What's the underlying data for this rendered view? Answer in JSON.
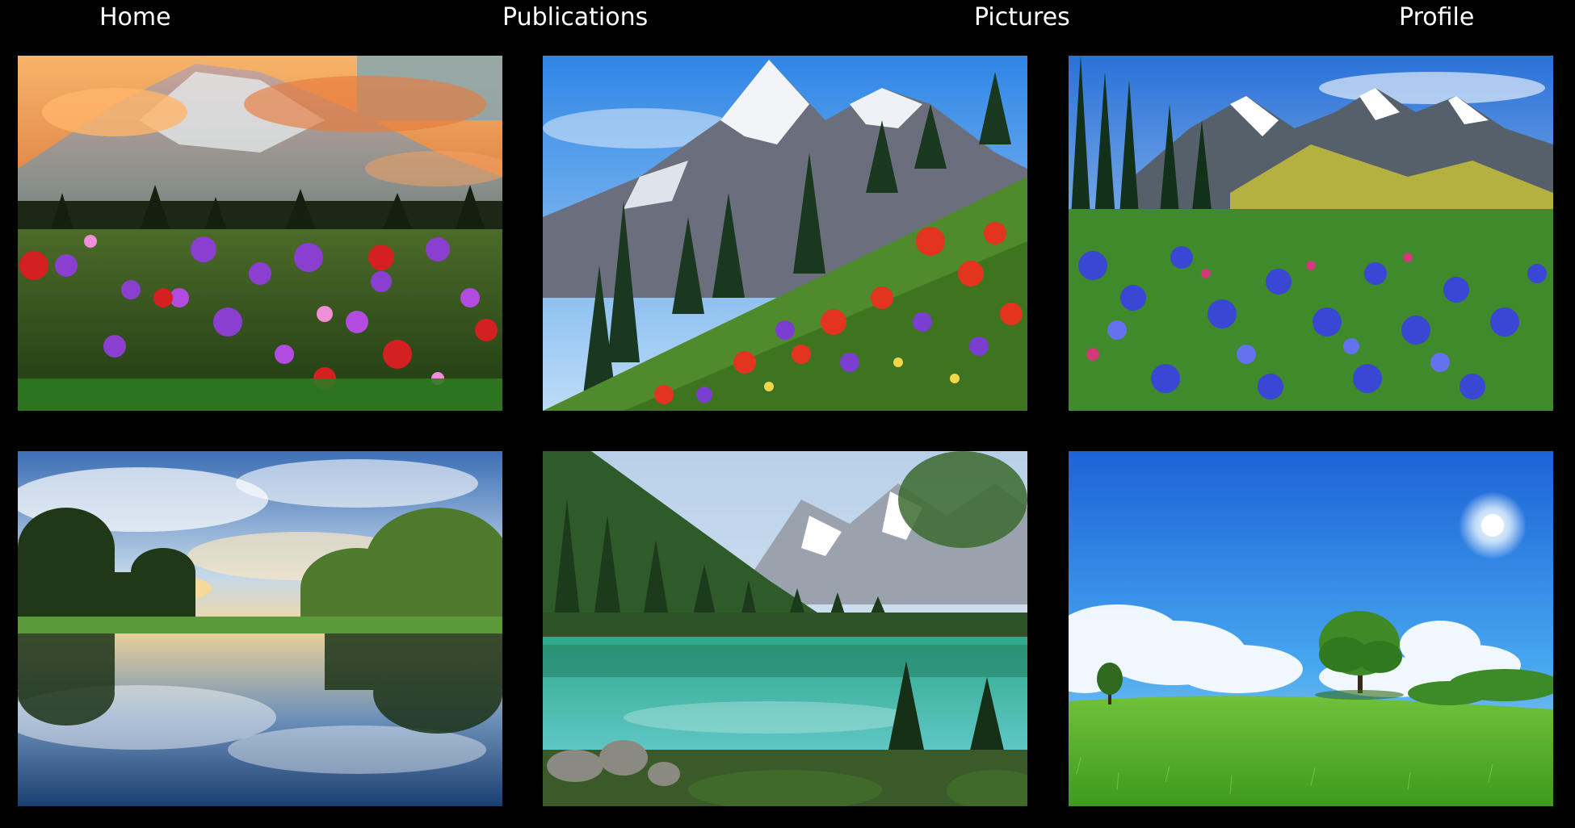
{
  "nav": {
    "home": "Home",
    "publications": "Publications",
    "pictures": "Pictures",
    "profile": "Profile"
  },
  "gallery": {
    "tiles": [
      {
        "subject": "sunset mountain with cloud and wildflower meadow"
      },
      {
        "subject": "steep mountain slope with red and purple wildflowers"
      },
      {
        "subject": "snowy peaks over blue lupine meadow"
      },
      {
        "subject": "river reflecting clouds and forest at sunset"
      },
      {
        "subject": "turquoise alpine lake with forest and peaks"
      },
      {
        "subject": "green grass hill with tree, clouds and sun"
      }
    ]
  },
  "colors": {
    "background": "#000000",
    "nav_text": "#ffffff"
  }
}
